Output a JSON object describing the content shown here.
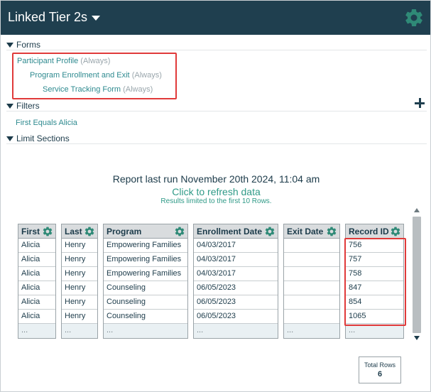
{
  "header": {
    "title": "Linked Tier 2s"
  },
  "sections": {
    "forms": "Forms",
    "filters": "Filters",
    "limit": "Limit Sections"
  },
  "forms": [
    {
      "name": "Participant Profile",
      "qualifier": "(Always)"
    },
    {
      "name": "Program Enrollment and Exit",
      "qualifier": "(Always)"
    },
    {
      "name": "Service Tracking Form",
      "qualifier": "(Always)"
    }
  ],
  "filters": {
    "items": [
      "First Equals Alicia"
    ]
  },
  "report": {
    "last_run": "Report last run November 20th 2024, 11:04 am",
    "refresh": "Click to refresh data",
    "limit_note": "Results limited to the first 10 Rows."
  },
  "table": {
    "columns": [
      {
        "label": "First",
        "values": [
          "Alicia",
          "Alicia",
          "Alicia",
          "Alicia",
          "Alicia",
          "Alicia"
        ]
      },
      {
        "label": "Last",
        "values": [
          "Henry",
          "Henry",
          "Henry",
          "Henry",
          "Henry",
          "Henry"
        ]
      },
      {
        "label": "Program",
        "values": [
          "Empowering Families",
          "Empowering Families",
          "Empowering Families",
          "Counseling",
          "Counseling",
          "Counseling"
        ]
      },
      {
        "label": "Enrollment Date",
        "values": [
          "04/03/2017",
          "04/03/2017",
          "04/03/2017",
          "06/05/2023",
          "06/05/2023",
          "06/05/2023"
        ]
      },
      {
        "label": "Exit Date",
        "values": [
          "",
          "",
          "",
          "",
          "",
          ""
        ]
      },
      {
        "label": "Record ID",
        "values": [
          "756",
          "757",
          "758",
          "847",
          "854",
          "1065"
        ]
      }
    ],
    "ellipsis": "..."
  },
  "totals": {
    "label": "Total Rows",
    "value": "6"
  },
  "colors": {
    "header_bg": "#1f3f4f",
    "accent_teal": "#2f9a87",
    "gear": "#2f8a77",
    "highlight_red": "#e03a3a"
  }
}
